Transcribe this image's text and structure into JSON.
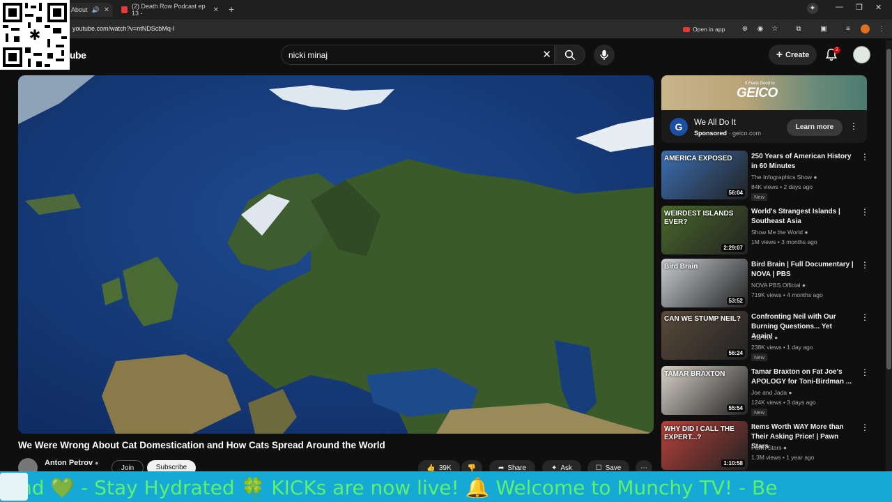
{
  "browser": {
    "tabs": [
      {
        "label": "About",
        "active": true
      },
      {
        "label": "(2) Death Row Podcast ep 13 -",
        "active": false
      }
    ],
    "url": "youtube.com/watch?v=ntNDScbMq-I",
    "open_in_app": "Open in app"
  },
  "header": {
    "logo": "ube",
    "search_value": "nicki minaj",
    "create_label": "Create",
    "notification_count": "2"
  },
  "video": {
    "title": "We Were Wrong About Cat Domestication and How Cats Spread Around the World",
    "channel": "Anton Petrov",
    "join": "Join",
    "subscribe": "Subscribe",
    "likes": "39K",
    "share": "Share",
    "ask": "Ask",
    "save": "Save"
  },
  "ad": {
    "banner_small": "It Feels Good to",
    "banner_brand": "GEICO",
    "logo_letter": "G",
    "title": "We All Do It",
    "sponsored": "Sponsored",
    "domain": "geico.com",
    "cta": "Learn more"
  },
  "recommendations": [
    {
      "title": "250 Years of American History in 60 Minutes",
      "channel": "The Infographics Show",
      "meta": "84K views • 2 days ago",
      "duration": "56:04",
      "badge": "New",
      "thumb_text": "AMERICA EXPOSED",
      "color": "#3b6fb3"
    },
    {
      "title": "World's Strangest Islands | Southeast Asia",
      "channel": "Show Me the World",
      "meta": "1M views • 3 months ago",
      "duration": "2:29:07",
      "badge": "",
      "thumb_text": "WEIRDEST ISLANDS EVER?",
      "color": "#4a6a2a"
    },
    {
      "title": "Bird Brain | Full Documentary | NOVA | PBS",
      "channel": "NOVA PBS Official",
      "meta": "719K views • 4 months ago",
      "duration": "53:52",
      "badge": "",
      "thumb_text": "Bird Brain",
      "color": "#c9ccd0"
    },
    {
      "title": "Confronting Neil with Our Burning Questions... Yet Again!",
      "channel": "StarTalk",
      "meta": "238K views • 1 day ago",
      "duration": "56:24",
      "badge": "New",
      "thumb_text": "CAN WE STUMP NEIL?",
      "color": "#5a4a3a"
    },
    {
      "title": "Tamar Braxton on Fat Joe's APOLOGY for Toni-Birdman ...",
      "channel": "Joe and Jada",
      "meta": "124K views • 3 days ago",
      "duration": "55:54",
      "badge": "New",
      "thumb_text": "TAMAR BRAXTON",
      "color": "#d8d2c8"
    },
    {
      "title": "Items Worth WAY More than Their Asking Price! | Pawn Stars",
      "channel": "Pawn Stars",
      "meta": "1.3M views • 1 year ago",
      "duration": "1:10:58",
      "badge": "",
      "thumb_text": "WHY DID I CALL THE EXPERT...?",
      "color": "#b8413a"
    }
  ],
  "ticker": {
    "text": "nd 💚 - Stay Hydrated 🍀 KICKs are now live! 🔔       Welcome to Munchy TV!  - Be"
  }
}
